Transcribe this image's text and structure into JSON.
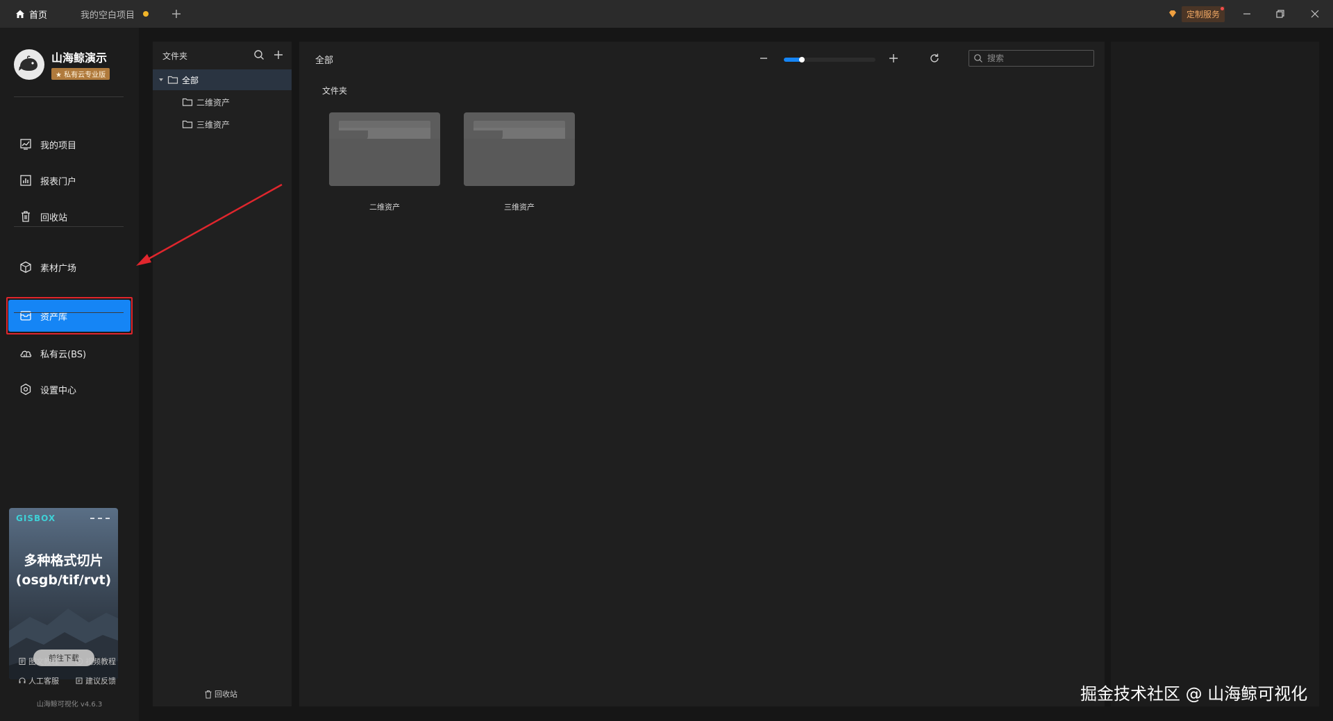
{
  "titlebar": {
    "tabs": [
      {
        "label": "首页",
        "icon": "home-icon"
      },
      {
        "label": "我的空白项目",
        "unsaved": true
      }
    ],
    "custom_service": "定制服务"
  },
  "sidebar": {
    "brand_name": "山海鲸演示",
    "edition": "★ 私有云专业版",
    "items": [
      {
        "label": "我的项目",
        "icon": "chart-icon"
      },
      {
        "label": "报表门户",
        "icon": "report-icon"
      },
      {
        "label": "回收站",
        "icon": "trash-icon"
      },
      {
        "label": "素材广场",
        "icon": "cube-icon"
      },
      {
        "label": "资产库",
        "icon": "asset-icon",
        "active": true
      },
      {
        "label": "私有云(BS)",
        "icon": "cloud-icon"
      },
      {
        "label": "设置中心",
        "icon": "gear-icon"
      }
    ],
    "promo": {
      "brand": "GISBOX",
      "line1": "多种格式切片",
      "line2": "(osgb/tif/rvt)",
      "button": "前往下载"
    },
    "help": {
      "tutorial": "图文教程",
      "video": "视频教程",
      "support": "人工客服",
      "feedback": "建议反馈"
    },
    "version": "山海鲸可视化 v4.6.3"
  },
  "folder_panel": {
    "title": "文件夹",
    "tree": [
      {
        "label": "全部",
        "level": 0,
        "selected": true
      },
      {
        "label": "二维资产",
        "level": 1
      },
      {
        "label": "三维资产",
        "level": 1
      }
    ],
    "recycle": "回收站"
  },
  "main": {
    "title": "全部",
    "zoom_level": 0.2,
    "search_placeholder": "搜索",
    "section_label": "文件夹",
    "folders": [
      "二维资产",
      "三维资产"
    ]
  },
  "watermark": "掘金技术社区 @ 山海鲸可视化",
  "colors": {
    "accent": "#1585f5",
    "highlight": "#e0262d"
  }
}
